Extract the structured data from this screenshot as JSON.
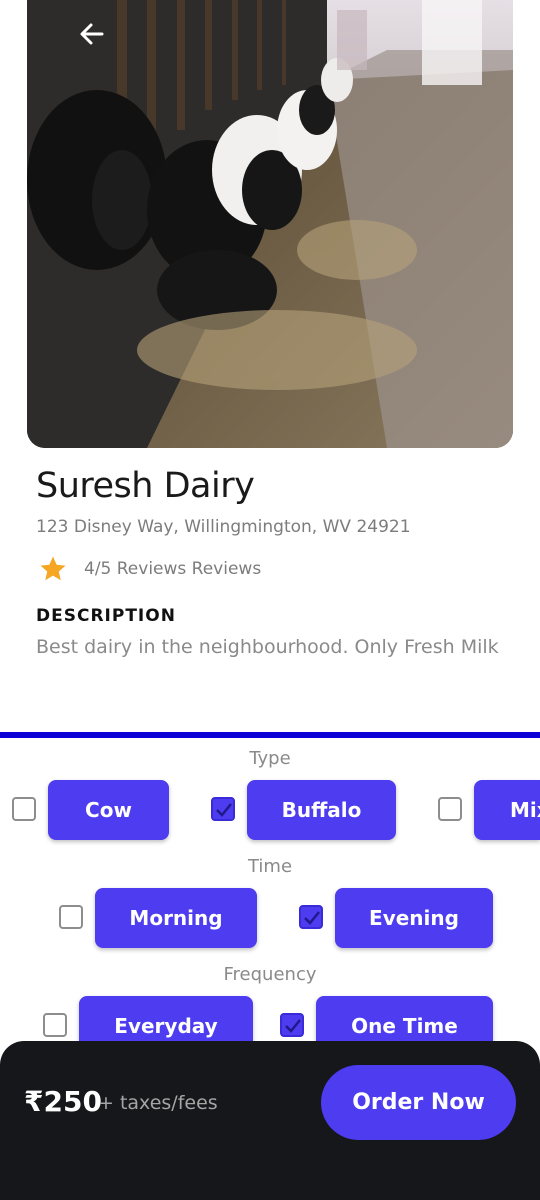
{
  "header": {
    "back_icon": "arrow-left-icon"
  },
  "hero": {
    "image_subject": "cows feeding in a barn"
  },
  "dairy": {
    "name": "Suresh Dairy",
    "address": "123 Disney Way, Willingmington, WV 24921",
    "rating_text": "4/5 Reviews Reviews",
    "description_heading": "DESCRIPTION",
    "description": "Best dairy in the neighbourhood.  Only Fresh Milk"
  },
  "options": {
    "type": {
      "label": "Type",
      "items": [
        {
          "label": "Cow",
          "checked": false
        },
        {
          "label": "Buffalo",
          "checked": true
        },
        {
          "label": "Mix",
          "checked": false
        }
      ]
    },
    "time": {
      "label": "Time",
      "items": [
        {
          "label": "Morning",
          "checked": false
        },
        {
          "label": "Evening",
          "checked": true
        }
      ]
    },
    "frequency": {
      "label": "Frequency",
      "items": [
        {
          "label": "Everyday",
          "checked": false
        },
        {
          "label": "One Time",
          "checked": true
        }
      ]
    }
  },
  "footer": {
    "price": "₹250",
    "price_suffix": "+ taxes/fees",
    "order_label": "Order Now"
  },
  "colors": {
    "accent": "#4d3cf0",
    "divider": "#0b00d6",
    "footer_bg": "#15171a",
    "star": "#f5a623"
  }
}
